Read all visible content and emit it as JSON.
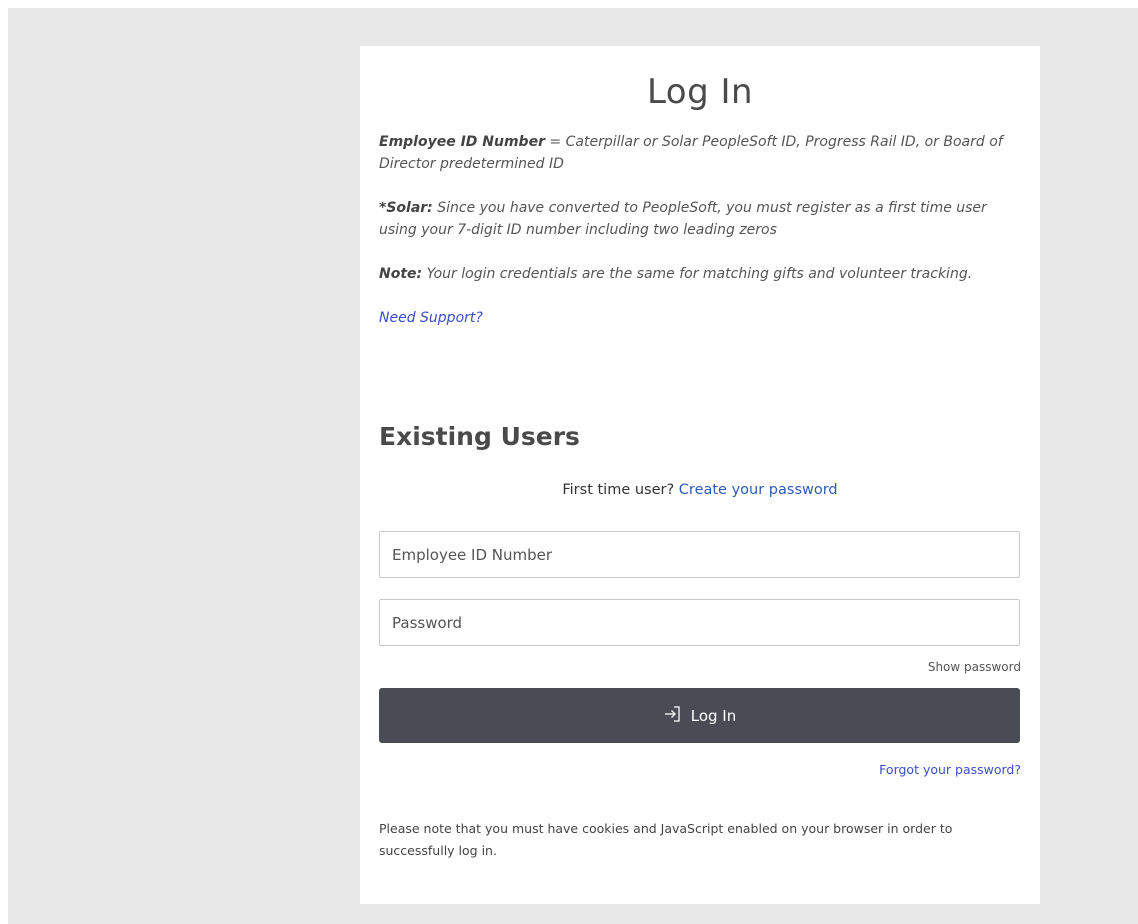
{
  "page": {
    "title": "Log In",
    "info": {
      "employee_id_label": "Employee ID Number",
      "employee_id_text": " = Caterpillar or Solar PeopleSoft ID, Progress Rail ID, or Board of Director predetermined ID",
      "solar_label": "*Solar:",
      "solar_text": " Since you have converted to PeopleSoft, you must register as a first time user using your 7-digit ID number including two leading zeros",
      "note_label": "Note:",
      "note_text": " Your login credentials are the same for matching gifts and volunteer tracking.",
      "support_link": "Need Support?"
    },
    "existing_users": {
      "heading": "Existing Users",
      "first_time_text": "First time user?",
      "create_password_link": "Create your password"
    },
    "form": {
      "employee_id_placeholder": "Employee ID Number",
      "employee_id_value": "",
      "password_placeholder": "Password",
      "password_value": "",
      "show_password": "Show password",
      "login_button": "Log In",
      "login_icon": "sign-in-icon",
      "forgot_password": "Forgot your password?"
    },
    "footer_note": "Please note that you must have cookies and JavaScript enabled on your browser in order to successfully log in."
  },
  "colors": {
    "background": "#e8e8e8",
    "card": "#ffffff",
    "button": "#494c55",
    "link": "#3b4ec8"
  }
}
